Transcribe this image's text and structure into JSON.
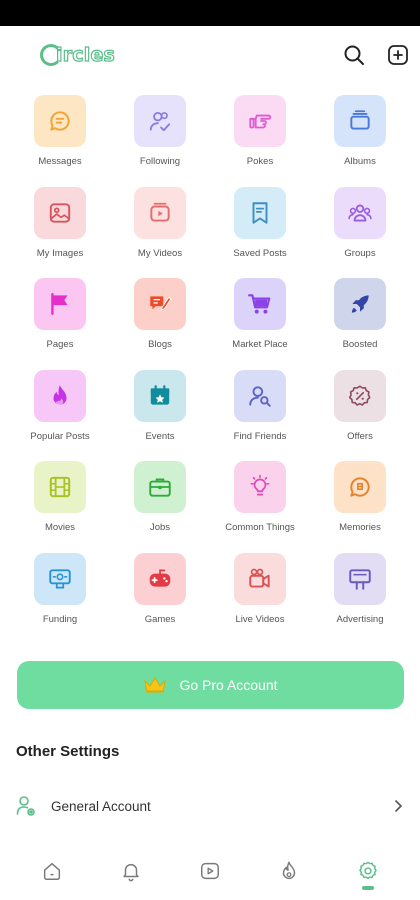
{
  "app": {
    "logo_text": "ircles",
    "logo_alt": "Circles"
  },
  "topbar": {
    "search_icon": "search-icon",
    "add_icon": "add-square-icon"
  },
  "tiles": [
    {
      "label": "Messages",
      "icon": "chat-icon",
      "bg": "#fde6c3",
      "fg": "#f2a531"
    },
    {
      "label": "Following",
      "icon": "users-check-icon",
      "bg": "#e6e2fb",
      "fg": "#8a7be0"
    },
    {
      "label": "Pokes",
      "icon": "hand-point-icon",
      "bg": "#fbdaf4",
      "fg": "#e05cd0"
    },
    {
      "label": "Albums",
      "icon": "album-icon",
      "bg": "#d6e4fb",
      "fg": "#4a78d8"
    },
    {
      "label": "My Images",
      "icon": "image-icon",
      "bg": "#fad9dc",
      "fg": "#d8555f"
    },
    {
      "label": "My Videos",
      "icon": "video-icon",
      "bg": "#fde0e0",
      "fg": "#e46d6d"
    },
    {
      "label": "Saved Posts",
      "icon": "bookmark-icon",
      "bg": "#d4ecf8",
      "fg": "#3d8fc4"
    },
    {
      "label": "Groups",
      "icon": "group-icon",
      "bg": "#ebdcfb",
      "fg": "#9a5ddb"
    },
    {
      "label": "Pages",
      "icon": "flag-icon",
      "bg": "#fbc6f1",
      "fg": "#e62ec8"
    },
    {
      "label": "Blogs",
      "icon": "blog-icon",
      "bg": "#fcd0c8",
      "fg": "#ee4b2b"
    },
    {
      "label": "Market Place",
      "icon": "cart-icon",
      "bg": "#dcd3fb",
      "fg": "#8b41e8"
    },
    {
      "label": "Boosted",
      "icon": "rocket-icon",
      "bg": "#cfd5ea",
      "fg": "#3245a7"
    },
    {
      "label": "Popular Posts",
      "icon": "fire-icon",
      "bg": "#f7c8f7",
      "fg": "#c732e6"
    },
    {
      "label": "Events",
      "icon": "calendar-icon",
      "bg": "#c9e7ec",
      "fg": "#0f8c9e"
    },
    {
      "label": "Find Friends",
      "icon": "user-search-icon",
      "bg": "#d9dcf7",
      "fg": "#5c65c8"
    },
    {
      "label": "Offers",
      "icon": "offer-icon",
      "bg": "#ede0e4",
      "fg": "#8a4e62"
    },
    {
      "label": "Movies",
      "icon": "film-icon",
      "bg": "#e9f3c8",
      "fg": "#a8c022"
    },
    {
      "label": "Jobs",
      "icon": "briefcase-icon",
      "bg": "#d0f1d1",
      "fg": "#2eab3a"
    },
    {
      "label": "Common Things",
      "icon": "bulb-icon",
      "bg": "#fbd2ec",
      "fg": "#de4db7"
    },
    {
      "label": "Memories",
      "icon": "memory-icon",
      "bg": "#fde2c8",
      "fg": "#e5832d"
    },
    {
      "label": "Funding",
      "icon": "funding-icon",
      "bg": "#cde6f8",
      "fg": "#2893d3"
    },
    {
      "label": "Games",
      "icon": "gamepad-icon",
      "bg": "#fccfd2",
      "fg": "#e33a43"
    },
    {
      "label": "Live Videos",
      "icon": "camera-icon",
      "bg": "#fbdcdc",
      "fg": "#d95555"
    },
    {
      "label": "Advertising",
      "icon": "billboard-icon",
      "bg": "#e2ddf5",
      "fg": "#6b5ab8"
    }
  ],
  "pro": {
    "label": "Go Pro Account",
    "icon": "crown-icon",
    "bg": "#6fdca0"
  },
  "settings": {
    "title": "Other Settings",
    "items": [
      {
        "label": "General Account",
        "icon": "user-gear-icon"
      }
    ]
  },
  "bottom_nav": [
    {
      "name": "home",
      "icon": "home-icon",
      "active": false
    },
    {
      "name": "notifications",
      "icon": "bell-icon",
      "active": false
    },
    {
      "name": "videos",
      "icon": "play-icon",
      "active": false
    },
    {
      "name": "popular",
      "icon": "fire-icon",
      "active": false
    },
    {
      "name": "settings",
      "icon": "gear-icon",
      "active": true
    }
  ],
  "colors": {
    "accent": "#5bbf8a",
    "nav_icon": "#7a7a7a"
  }
}
